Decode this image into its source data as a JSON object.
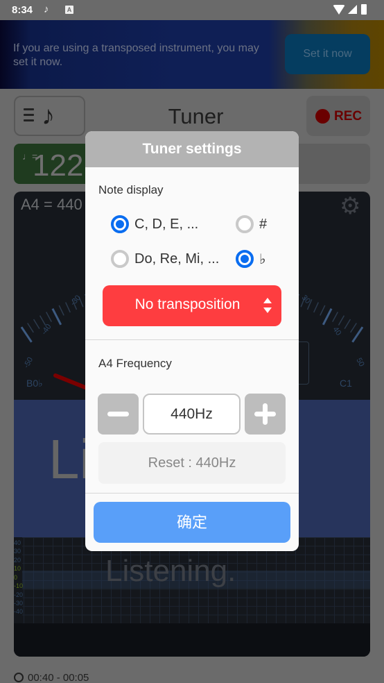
{
  "status_bar": {
    "time": "8:34",
    "icons": [
      "tuner-app-notification-icon",
      "a-keyboard-icon",
      "wifi-icon",
      "signal-icon",
      "battery-charging-icon"
    ],
    "keyboard_glyph": "A",
    "notif_glyph": "♪"
  },
  "banner": {
    "message": "If you are using a transposed instrument, you may set it now.",
    "button_label": "Set it now"
  },
  "header": {
    "title": "Tuner",
    "logo_glyph": "♪",
    "rec_label": "REC"
  },
  "bpm": {
    "note_glyph": "♩=",
    "value": "122"
  },
  "tuner_panel": {
    "a4_label": "A4 = 440",
    "gear_glyph": "⚙",
    "gauge_ticks_left": [
      "-50",
      "-40",
      "-30"
    ],
    "gauge_ticks_right": [
      "30",
      "40",
      "50"
    ],
    "note_left": "B0♭",
    "note_right": "C1",
    "big_status": "Listening.",
    "graph_status": "Listening.",
    "graph_y_labels": [
      "40",
      "30",
      "20",
      "10",
      "0",
      "-10",
      "-20",
      "-30",
      "-40"
    ],
    "colors": {
      "needle": "#7a0000",
      "in_tune_band": "#546d18"
    }
  },
  "timer": "00:40 - 00:05",
  "dialog": {
    "title": "Tuner settings",
    "note_display_label": "Note display",
    "options": {
      "letters": {
        "label": "C, D, E, ...",
        "selected": true
      },
      "solfege": {
        "label": "Do, Re, Mi, ...",
        "selected": false
      },
      "sharp": {
        "label": "#",
        "selected": false
      },
      "flat": {
        "label": "♭",
        "selected": true
      }
    },
    "transposition": "No transposition",
    "a4_frequency_label": "A4 Frequency",
    "frequency_value": "440Hz",
    "reset_label": "Reset : 440Hz",
    "ok_label": "确定",
    "colors": {
      "radio_on": "#0a6df0",
      "select_bg": "#fe3d40",
      "ok_bg": "#599ff9"
    }
  }
}
